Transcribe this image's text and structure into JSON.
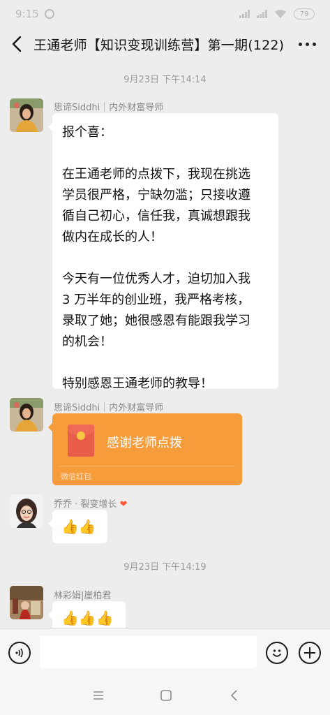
{
  "status": {
    "time": "9:15",
    "battery": "79"
  },
  "header": {
    "title": "王通老师【知识变现训练营】第一期(122)"
  },
  "timestamps": [
    "9月23日 下午14:14",
    "9月23日 下午14:19"
  ],
  "messages": [
    {
      "sender": "思谛Siddhi｜内外财富导师",
      "lines": [
        "报个喜：",
        "",
        "在王通老师的点拨下，我现在挑选",
        "学员很严格，宁缺勿滥；只接收遵",
        "循自己初心，信任我，真诚想跟我",
        "做内在成长的人！",
        "",
        "今天有一位优秀人才，迫切加入我",
        "3 万半年的创业班，我严格考核，",
        "录取了她；她很感恩有能跟我学习",
        "的机会！",
        "",
        "特别感恩王通老师的教导！"
      ]
    },
    {
      "sender": "思谛Siddhi｜内外财富导师",
      "red_packet": {
        "title": "感谢老师点拨",
        "footer": "微信红包"
      }
    },
    {
      "sender": "乔乔 · 裂变增长",
      "sender_heart": "❤",
      "content": "👍👍"
    },
    {
      "sender": "林彩娟|崖柏君",
      "content": "👍👍👍"
    }
  ],
  "input": {
    "placeholder": ""
  },
  "colors": {
    "background": "#ededed",
    "red_packet": "#f79c3a",
    "bubble": "#ffffff"
  }
}
